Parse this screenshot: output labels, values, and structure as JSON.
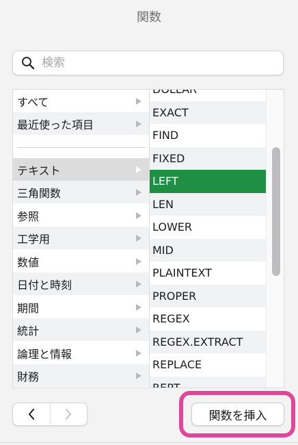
{
  "header": {
    "title": "関数"
  },
  "search": {
    "placeholder": "検索",
    "value": ""
  },
  "categories": [
    {
      "label": "すべて"
    },
    {
      "label": "最近使った項目"
    },
    {
      "label": "テキスト",
      "selected": true
    },
    {
      "label": "三角関数"
    },
    {
      "label": "参照"
    },
    {
      "label": "工学用"
    },
    {
      "label": "数値"
    },
    {
      "label": "日付と時刻"
    },
    {
      "label": "期間"
    },
    {
      "label": "統計"
    },
    {
      "label": "論理と情報"
    },
    {
      "label": "財務"
    }
  ],
  "functions": [
    {
      "label": "DOLLAR"
    },
    {
      "label": "EXACT"
    },
    {
      "label": "FIND"
    },
    {
      "label": "FIXED"
    },
    {
      "label": "LEFT",
      "selected": true
    },
    {
      "label": "LEN"
    },
    {
      "label": "LOWER"
    },
    {
      "label": "MID"
    },
    {
      "label": "PLAINTEXT"
    },
    {
      "label": "PROPER"
    },
    {
      "label": "REGEX"
    },
    {
      "label": "REGEX.EXTRACT"
    },
    {
      "label": "REPLACE"
    },
    {
      "label": "REPT"
    }
  ],
  "buttons": {
    "insert_function": "関数を挿入"
  },
  "colors": {
    "selected_function": "#1f8f45",
    "highlight_border": "#e0479a",
    "selected_category": "#dcdcdc"
  }
}
